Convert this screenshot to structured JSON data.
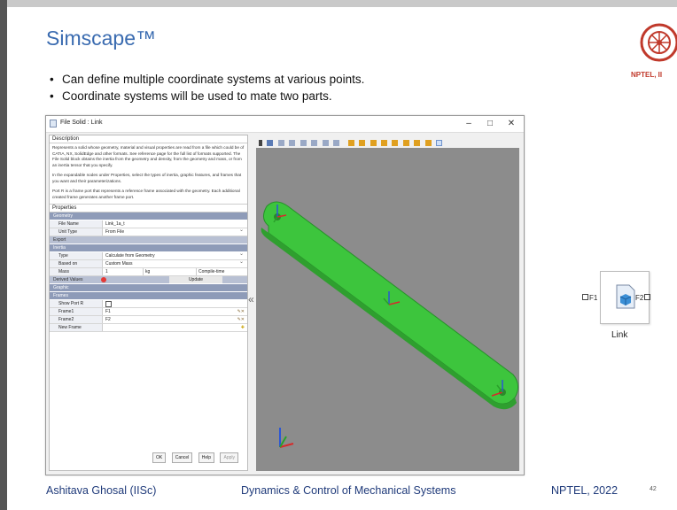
{
  "slide": {
    "title": "Simscape™",
    "bullets": [
      "Can define multiple coordinate systems at various points.",
      "Coordinate systems will be used to mate two parts."
    ],
    "logo_text": "NPTEL, II"
  },
  "dialog": {
    "title": "File Solid : Link",
    "window_buttons": [
      "–",
      "□",
      "✕"
    ],
    "description_header": "Description",
    "description_text": [
      "Represents a solid whose geometry, material and visual properties are read from a file which could be of CATIA, NX, SolidEdge and other formats. See reference page for the full list of formats supported. The File Solid block obtains the inertia from the geometry and density, from the geometry and mass, or from an inertia tensor that you specify.",
      "In the expandable nodes under Properties, select the types of inertia, graphic features, and frames that you want and their parameterizations.",
      "Port R is a frame port that represents a reference frame associated with the geometry. Each additional created frame generates another frame port."
    ],
    "properties_header": "Properties",
    "sections": {
      "geometry": "Geometry",
      "export": "Export",
      "inertia": "Inertia",
      "derived": "Derived Values",
      "graphic": "Graphic",
      "frames": "Frames"
    },
    "rows": {
      "file_name": {
        "label": "File Name",
        "value": "Link_1a_t"
      },
      "unit_type": {
        "label": "Unit Type",
        "value": "From File"
      },
      "type": {
        "label": "Type",
        "value": "Calculate from Geometry"
      },
      "based_on": {
        "label": "Based on",
        "value": "Custom Mass"
      },
      "mass": {
        "label": "Mass",
        "value": "1",
        "unit": "kg",
        "mode": "Compile-time"
      },
      "update": "Update",
      "show_port_r": {
        "label": "Show Port R"
      },
      "frame1": {
        "label": "Frame1",
        "value": "F1"
      },
      "frame2": {
        "label": "Frame2",
        "value": "F2"
      },
      "new_frame": {
        "label": "New Frame"
      }
    },
    "buttons": [
      "OK",
      "Cancel",
      "Help",
      "Apply"
    ]
  },
  "simulink_block": {
    "left_port": "F1",
    "right_port": "F2",
    "name": "Link"
  },
  "footer": {
    "author": "Ashitava Ghosal (IISc)",
    "course": "Dynamics & Control of Mechanical Systems",
    "org": "NPTEL, 2022",
    "page": "42"
  },
  "colors": {
    "title_blue": "#3a6bb0",
    "link_green": "#3dc53d",
    "viewport_gray": "#8c8c8c",
    "footer_blue": "#1f3a7a"
  }
}
